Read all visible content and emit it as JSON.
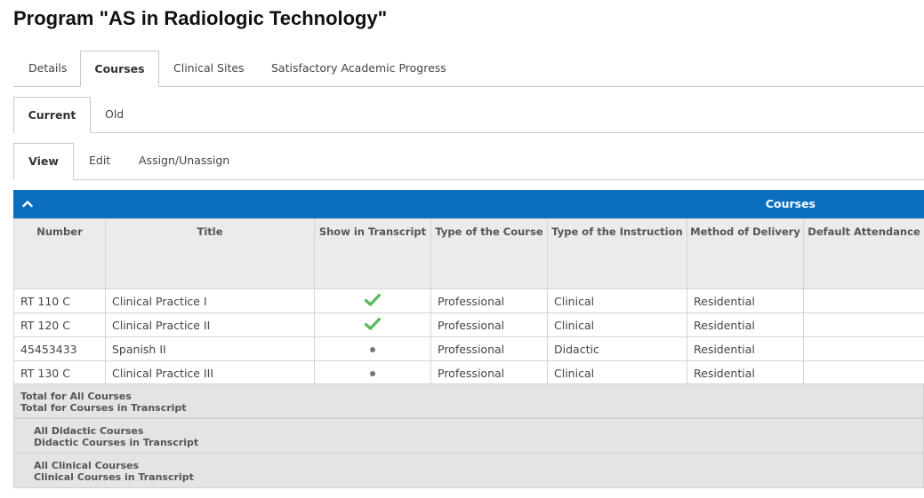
{
  "page": {
    "title": "Program \"AS in Radiologic Technology\""
  },
  "tabs_main": [
    "Details",
    "Courses",
    "Clinical Sites",
    "Satisfactory Academic Progress"
  ],
  "tabs_period": [
    "Current",
    "Old"
  ],
  "tabs_mode": [
    "View",
    "Edit",
    "Assign/Unassign"
  ],
  "grid": {
    "title": "Courses",
    "toggle_icon": "chevron-up-icon",
    "colors": {
      "header_bar": "#0a6dbd",
      "check": "#5cb85c"
    },
    "columns": [
      "Number",
      "Title",
      "Show in Transcript",
      "Type of the Course",
      "Type of the Instruction",
      "Method of Delivery",
      "Default Attendance"
    ],
    "rows": [
      {
        "number": "RT 110 C",
        "title": "Clinical Practice I",
        "in_transcript": "check-icon",
        "course_type": "Professional",
        "instruction": "Clinical",
        "delivery": "Residential",
        "attendance": ""
      },
      {
        "number": "RT 120 C",
        "title": "Clinical Practice II",
        "in_transcript": "check-icon",
        "course_type": "Professional",
        "instruction": "Clinical",
        "delivery": "Residential",
        "attendance": ""
      },
      {
        "number": "45453433",
        "title": "Spanish II",
        "in_transcript": "dot-icon",
        "course_type": "Professional",
        "instruction": "Didactic",
        "delivery": "Residential",
        "attendance": ""
      },
      {
        "number": "RT 130 C",
        "title": "Clinical Practice III",
        "in_transcript": "dot-icon",
        "course_type": "Professional",
        "instruction": "Clinical",
        "delivery": "Residential",
        "attendance": ""
      }
    ]
  },
  "summary": [
    {
      "line1": "Total for All Courses",
      "line2": "Total for Courses in Transcript"
    },
    {
      "line1": "All Didactic Courses",
      "line2": "Didactic Courses in Transcript"
    },
    {
      "line1": "All Clinical Courses",
      "line2": "Clinical Courses in Transcript"
    }
  ]
}
